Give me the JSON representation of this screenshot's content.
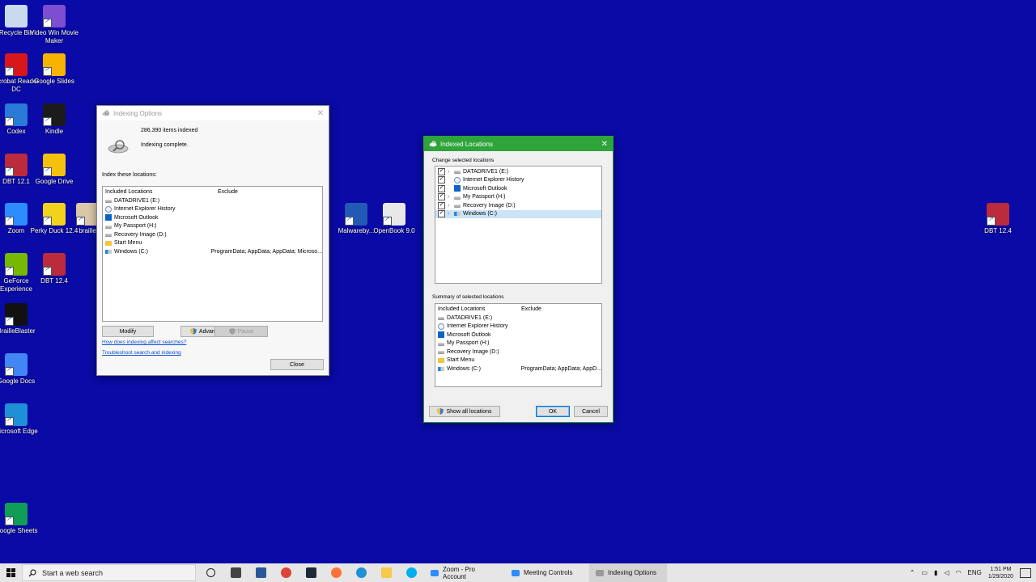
{
  "desktop": {
    "icons": [
      {
        "label": "Recycle Bin",
        "color": "#c9d9ee"
      },
      {
        "label": "Video Win Movie Maker",
        "color": "#7c4fd0"
      },
      {
        "label": "Acrobat Reader DC",
        "color": "#d9161b"
      },
      {
        "label": "Google Slides",
        "color": "#f4b400"
      },
      {
        "label": "Codex",
        "color": "#2a7ad8"
      },
      {
        "label": "Kindle",
        "color": "#1b1b1b"
      },
      {
        "label": "DBT 12.1",
        "color": "#bb2b3c"
      },
      {
        "label": "Google Drive",
        "color": "#f4c20d"
      },
      {
        "label": "Zoom",
        "color": "#2d8cff"
      },
      {
        "label": "Perky Duck 12.4",
        "color": "#f2d21b"
      },
      {
        "label": "braille",
        "color": "#d9c7a7"
      },
      {
        "label": "GeForce Experience",
        "color": "#76b900"
      },
      {
        "label": "DBT 12.4",
        "color": "#bb2b3c"
      },
      {
        "label": "BrailleBlaster",
        "color": "#111111"
      },
      {
        "label": "Google Docs",
        "color": "#4285f4"
      },
      {
        "label": "Microsoft Edge",
        "color": "#1f8fd6"
      },
      {
        "label": "Google Sheets",
        "color": "#0f9d58"
      },
      {
        "label": "Malwareby...",
        "color": "#2259b5"
      },
      {
        "label": "OpenBook 9.0",
        "color": "#e8e8e8"
      },
      {
        "label": "DBT 12.4",
        "color": "#bb2b3c"
      }
    ]
  },
  "indexing_options": {
    "title": "Indexing Options",
    "items_indexed": "286,390 items indexed",
    "status": "Indexing complete.",
    "index_these": "Index these locations:",
    "col_included": "Included Locations",
    "col_exclude": "Exclude",
    "locations": [
      {
        "name": "DATADRIVE1 (E:)",
        "exclude": "",
        "icon": "drive-icon"
      },
      {
        "name": "Internet Explorer History",
        "exclude": "",
        "icon": "ie-history-icon"
      },
      {
        "name": "Microsoft Outlook",
        "exclude": "",
        "icon": "outlook-icon"
      },
      {
        "name": "My Passport (H:)",
        "exclude": "",
        "icon": "drive-icon"
      },
      {
        "name": "Recovery Image (D:)",
        "exclude": "",
        "icon": "drive-icon"
      },
      {
        "name": "Start Menu",
        "exclude": "",
        "icon": "folder-icon"
      },
      {
        "name": "Windows (C:)",
        "exclude": "ProgramData; AppData; AppData; Microso...",
        "icon": "windows-drive-icon"
      }
    ],
    "modify": "Modify",
    "advanced": "Advanced",
    "pause": "Pause",
    "link1": "How does indexing affect searches?",
    "link2": "Troubleshoot search and indexing",
    "close": "Close"
  },
  "indexed_locations": {
    "title": "Indexed Locations",
    "change_label": "Change selected locations",
    "tree": [
      {
        "name": "DATADRIVE1 (E:)",
        "checked": true,
        "expandable": true,
        "icon": "drive-icon"
      },
      {
        "name": "Internet Explorer History",
        "checked": true,
        "expandable": false,
        "icon": "ie-history-icon"
      },
      {
        "name": "Microsoft Outlook",
        "checked": true,
        "expandable": false,
        "icon": "outlook-icon"
      },
      {
        "name": "My Passport (H:)",
        "checked": true,
        "expandable": true,
        "icon": "drive-icon"
      },
      {
        "name": "Recovery Image (D:)",
        "checked": true,
        "expandable": true,
        "icon": "drive-icon"
      },
      {
        "name": "Windows (C:)",
        "checked": true,
        "expandable": true,
        "icon": "windows-drive-icon",
        "selected": true
      }
    ],
    "summary_label": "Summary of selected locations",
    "col_included": "Included Locations",
    "col_exclude": "Exclude",
    "summary": [
      {
        "name": "DATADRIVE1 (E:)",
        "exclude": "",
        "icon": "drive-icon"
      },
      {
        "name": "Internet Explorer History",
        "exclude": "",
        "icon": "ie-history-icon"
      },
      {
        "name": "Microsoft Outlook",
        "exclude": "",
        "icon": "outlook-icon"
      },
      {
        "name": "My Passport (H:)",
        "exclude": "",
        "icon": "drive-icon"
      },
      {
        "name": "Recovery Image (D:)",
        "exclude": "",
        "icon": "drive-icon"
      },
      {
        "name": "Start Menu",
        "exclude": "",
        "icon": "folder-icon"
      },
      {
        "name": "Windows (C:)",
        "exclude": "ProgramData; AppData; AppD...",
        "icon": "windows-drive-icon"
      }
    ],
    "show_all": "Show all locations",
    "ok": "OK",
    "cancel": "Cancel"
  },
  "taskbar": {
    "search_placeholder": "Start a web search",
    "apps": [
      {
        "name": "Cortana",
        "color": "#222222"
      },
      {
        "name": "Task View",
        "color": "#444444"
      },
      {
        "name": "Word",
        "color": "#2b579a"
      },
      {
        "name": "Chrome",
        "color": "#db4437"
      },
      {
        "name": "Inkscape-like",
        "color": "#1c2a3a"
      },
      {
        "name": "Firefox",
        "color": "#ff7139"
      },
      {
        "name": "Edge",
        "color": "#1f8fd6"
      },
      {
        "name": "File Explorer",
        "color": "#f7c948"
      },
      {
        "name": "Skype",
        "color": "#00aff0"
      }
    ],
    "labeled": [
      {
        "label": "Zoom - Pro Account",
        "color": "#2d8cff"
      },
      {
        "label": "Meeting Controls",
        "color": "#2d8cff"
      },
      {
        "label": "Indexing Options",
        "color": "#9a9a9a"
      }
    ],
    "lang": "ENG",
    "time": "1:51 PM",
    "date": "1/29/2020"
  }
}
